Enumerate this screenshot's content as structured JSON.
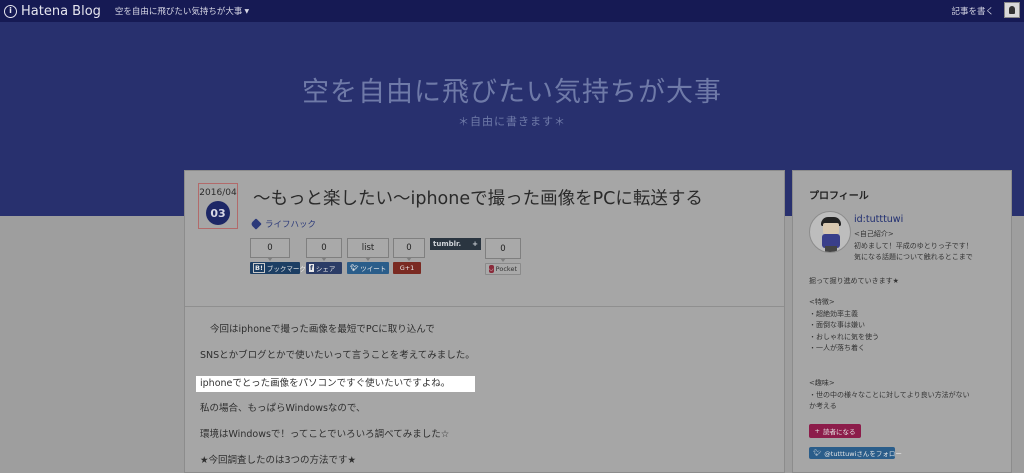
{
  "topbar": {
    "brand": "Hatena Blog",
    "blog_name": "空を自由に飛びたい気持ちが大事",
    "write_link": "記事を書く"
  },
  "header": {
    "title": "空を自由に飛びたい気持ちが大事",
    "subtitle": "＊自由に書きます＊"
  },
  "article": {
    "date_ym": "2016/04",
    "date_day": "03",
    "title": "～もっと楽したい～iphoneで撮った画像をPCに転送する",
    "category": "ライフハック",
    "share": {
      "hatena_count": "0",
      "hatena_label": "ブックマーク",
      "facebook_count": "0",
      "facebook_label": "シェア",
      "list_label": "list",
      "twitter_label": "ツイート",
      "gplus_count": "0",
      "gplus_label": "G+1",
      "tumblr_label": "tumblr.",
      "pocket_count": "0",
      "pocket_label": "Pocket"
    },
    "paragraphs": [
      "今回はiphoneで撮った画像を最短でPCに取り込んで",
      "SNSとかブログとかで使いたいって言うことを考えてみました。",
      "iphoneでとった画像をパソコンですぐ使いたいですよね。",
      "私の場合、もっぱらWindowsなので、",
      "環境はWindowsで！ってことでいろいろ調べてみました☆",
      "★今回調査したのは3つの方法です★"
    ]
  },
  "sidebar": {
    "heading": "プロフィール",
    "user_id": "id:tutttuwi",
    "intro_lines": [
      "<自己紹介>",
      "初めまして！平成のゆとりっ子です！",
      "気になる話題について触れるとこまで"
    ],
    "intro_last": "掘って掘り進めていきます★",
    "traits": [
      "<特徴>",
      "・超絶効率主義",
      "・面倒な事は嫌い",
      "・おしゃれに気を使う",
      "・一人が落ち着く"
    ],
    "hobby": [
      "<趣味>",
      "・世の中の様々なことに対してより良い方法がない",
      "か考える"
    ],
    "reader_button": "読者になる",
    "follow_button": "@tutttuwiさんをフォロー"
  }
}
